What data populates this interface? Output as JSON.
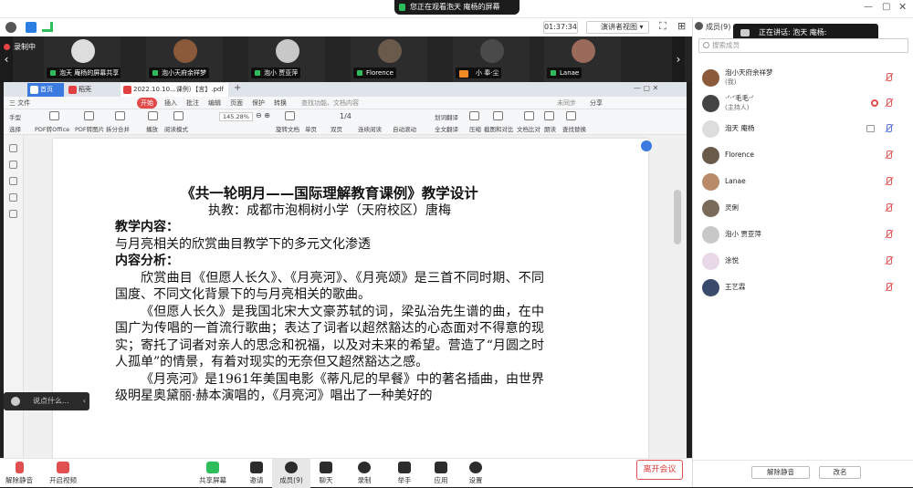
{
  "topbar": {
    "viewing_banner": "您正在观看泡天 庵杨的屏幕"
  },
  "infobar": {
    "timer": "01:37:34",
    "view_mode": "演讲者视图"
  },
  "recording": {
    "label": "录制中"
  },
  "thumbnails": [
    {
      "name": "泡天 庵杨的屏幕共享"
    },
    {
      "name": "泡小天府余祥梦"
    },
    {
      "name": "泡小 贾亚萍"
    },
    {
      "name": "Florence"
    },
    {
      "name": "小 奉·尘"
    },
    {
      "name": "Lanae"
    }
  ],
  "pdf": {
    "tabs": {
      "home": "首页",
      "draft": "稻壳",
      "file": "2022.10.10...课例）【言】.pdf"
    },
    "menu": [
      "三 文件",
      "开始",
      "插入",
      "批注",
      "编辑",
      "页面",
      "保护",
      "转换",
      "查找功能、文档内容",
      "未同步",
      "分享"
    ],
    "ribbon": {
      "row1": [
        "手型",
        "选择",
        "PDF转Office",
        "PDF转图片",
        "拆分合并",
        "播放",
        "阅读模式",
        "旋转文档",
        "单页",
        "双页",
        "连续阅读",
        "自动滚动",
        "全文翻译",
        "压缩",
        "截图和对比",
        "文档比对",
        "朗读",
        "查找替换"
      ],
      "zoom": "145.28%",
      "page": "1/4",
      "extra": [
        "划词翻译"
      ]
    },
    "doc": {
      "title": "《共一轮明月——国际理解教育课例》教学设计",
      "author": "执教：成都市泡桐树小学（天府校区）唐梅",
      "h1": "教学内容：",
      "p1": "与月亮相关的欣赏曲目教学下的多元文化渗透",
      "h2": "内容分析：",
      "p2": "欣赏曲目《但愿人长久》、《月亮河》、《月亮颂》是三首不同时期、不同国度、不同文化背景下的与月亮相关的歌曲。",
      "p3": "《但愿人长久》是我国北宋大文豪苏轼的词，梁弘治先生谱的曲，在中国广为传唱的一首流行歌曲；表达了词者以超然豁达的心态面对不得意的现实；寄托了词者对亲人的思念和祝福，以及对未来的希望。营造了“月圆之时人孤单”的情景，有着对现实的无奈但又超然豁达之感。",
      "p4": "《月亮河》是1961年美国电影《蒂凡尼的早餐》中的著名插曲，由世界级明星奥黛丽·赫本演唱的，《月亮河》唱出了一种美好的"
    }
  },
  "speak_prompt": "说点什么...",
  "controls": {
    "unmute": "解除静音",
    "start_video": "开启视频",
    "share": "共享屏幕",
    "invite": "邀请",
    "members": "成员(9)",
    "chat": "聊天",
    "record": "录制",
    "raise": "举手",
    "apps": "应用",
    "settings": "设置",
    "leave": "离开会议"
  },
  "panel": {
    "title": "成员(9)",
    "speaking": "正在讲话: 泡天 庵杨:",
    "search_placeholder": "搜索成员",
    "members": [
      {
        "name": "泡小天府余祥梦",
        "role": "(我)"
      },
      {
        "name": "·ᐟ·ᐟ毛毛·ᐟ",
        "role": "(主持人)"
      },
      {
        "name": "泡天 庵杨",
        "role": ""
      },
      {
        "name": "Florence",
        "role": ""
      },
      {
        "name": "Lanae",
        "role": ""
      },
      {
        "name": "灵俐",
        "role": ""
      },
      {
        "name": "泡小 贾亚萍",
        "role": ""
      },
      {
        "name": "涂悦",
        "role": ""
      },
      {
        "name": "王艺霖",
        "role": ""
      }
    ],
    "buttons": {
      "unmute_all": "解除静音",
      "rename": "改名"
    }
  },
  "colors": {
    "accent": "#2fbe5c",
    "danger": "#e03c3c",
    "dark": "#1f1f1f"
  }
}
